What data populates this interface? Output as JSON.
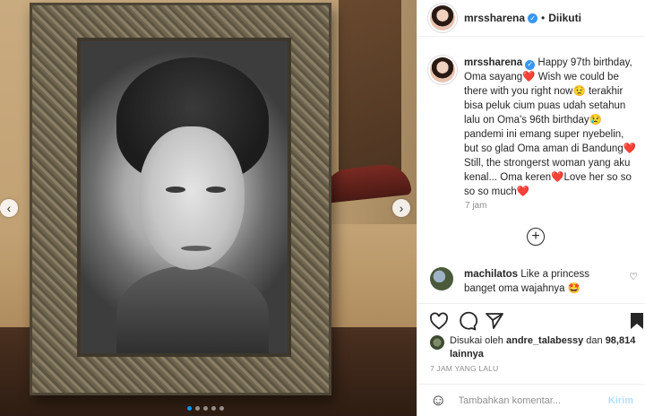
{
  "post": {
    "username": "mrssharena",
    "follow_status": "Diikuti",
    "separator": "•",
    "caption": "Happy 97th birthday, Oma sayang❤️ Wish we could be there with you right now😟 terakhir bisa peluk cium puas udah setahun lalu on Oma's 96th birthday😢 pandemi ini emang super nyebelin, but so glad Oma aman di Bandung❤️ Still, the strongerst woman yang aku kenal... Oma keren❤️Love her so so so so much❤️",
    "time_ago": "7 jam",
    "load_more_icon": "plus-circle-icon",
    "posted_label": "7 JAM YANG LALU"
  },
  "comment": {
    "username": "machilatos",
    "text": "Like a princess banget oma wajahnya 🤩"
  },
  "likes": {
    "prefix": "Disukai oleh",
    "user": "andre_talabessy",
    "connector": "dan",
    "count": "98,814 lainnya"
  },
  "comment_bar": {
    "emoji_icon": "smiley-icon",
    "placeholder": "Tambahkan komentar...",
    "post_label": "Kirim"
  },
  "carousel": {
    "total": 5,
    "active": 1
  },
  "colors": {
    "accent": "#0095f6",
    "verified": "#3897f0",
    "heart": "#ed4956"
  }
}
